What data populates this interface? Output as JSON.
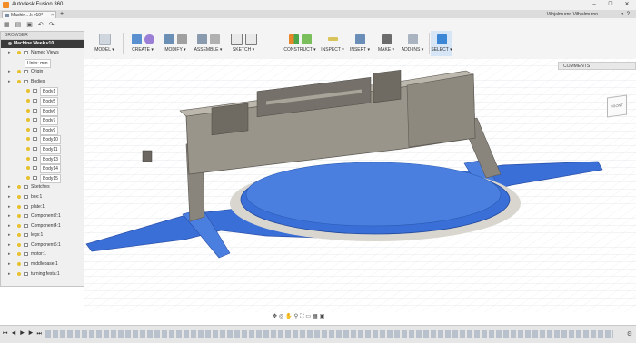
{
  "window": {
    "title": "Autodesk Fusion 360",
    "minimize": "–",
    "maximize": "☐",
    "close": "✕"
  },
  "tab": {
    "label": "Machin…k v10*",
    "close": "×",
    "new_tab": "+"
  },
  "user": {
    "name": "Vilhjalmurnn Vilhjalmurnn"
  },
  "toolbar": {
    "model": "MODEL ▾",
    "create": "CREATE ▾",
    "modify": "MODIFY ▾",
    "assemble": "ASSEMBLE ▾",
    "sketch": "SKETCH ▾",
    "construct": "CONSTRUCT ▾",
    "inspect": "INSPECT ▾",
    "insert": "INSERT ▾",
    "make": "MAKE ▾",
    "addins": "ADD-INS ▾",
    "select": "SELECT ▾"
  },
  "browser": {
    "header": "BROWSER",
    "root": "Machine Week v10",
    "items": [
      {
        "label": "Named Views",
        "indent": 0,
        "type": "folder"
      },
      {
        "label": "Units: mm",
        "indent": 0,
        "type": "units"
      },
      {
        "label": "Origin",
        "indent": 0,
        "type": "folder"
      },
      {
        "label": "Bodies",
        "indent": 0,
        "type": "folder"
      },
      {
        "label": "Body1",
        "indent": 1,
        "type": "body"
      },
      {
        "label": "Body5",
        "indent": 1,
        "type": "body"
      },
      {
        "label": "Body6",
        "indent": 1,
        "type": "body"
      },
      {
        "label": "Body7",
        "indent": 1,
        "type": "body"
      },
      {
        "label": "Body9",
        "indent": 1,
        "type": "body"
      },
      {
        "label": "Body10",
        "indent": 1,
        "type": "body"
      },
      {
        "label": "Body11",
        "indent": 1,
        "type": "body"
      },
      {
        "label": "Body13",
        "indent": 1,
        "type": "body"
      },
      {
        "label": "Body14",
        "indent": 1,
        "type": "body"
      },
      {
        "label": "Body15",
        "indent": 1,
        "type": "body"
      },
      {
        "label": "Sketches",
        "indent": 0,
        "type": "folder"
      },
      {
        "label": "box:1",
        "indent": 0,
        "type": "component"
      },
      {
        "label": "plate:1",
        "indent": 0,
        "type": "component"
      },
      {
        "label": "Component2:1",
        "indent": 0,
        "type": "component"
      },
      {
        "label": "Component4:1",
        "indent": 0,
        "type": "component"
      },
      {
        "label": "legs:1",
        "indent": 0,
        "type": "component"
      },
      {
        "label": "Component6:1",
        "indent": 0,
        "type": "component"
      },
      {
        "label": "motor:1",
        "indent": 0,
        "type": "component"
      },
      {
        "label": "middlebase:1",
        "indent": 0,
        "type": "component"
      },
      {
        "label": "turning festa:1",
        "indent": 0,
        "type": "component"
      }
    ]
  },
  "comments": {
    "label": "COMMENTS"
  },
  "viewcube": {
    "label": "FRONT"
  },
  "colors": {
    "plate_blue": "#3a6fd8",
    "frame_gray": "#8a857c",
    "select_blue": "#3b87d6"
  }
}
